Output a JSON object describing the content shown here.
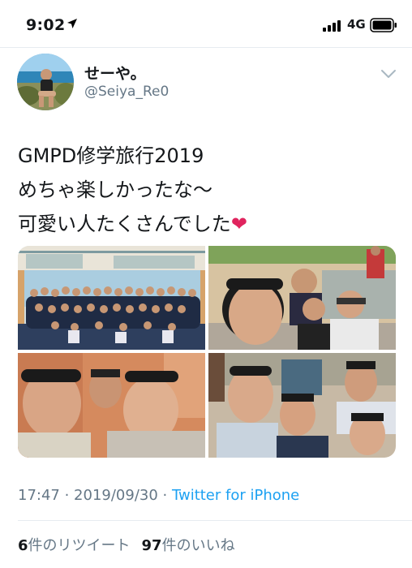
{
  "status_bar": {
    "time": "9:02",
    "network": "4G"
  },
  "tweet": {
    "display_name": "せーや。",
    "handle": "@Seiya_Re0",
    "text_lines": [
      "GMPD修学旅行2019",
      "めちゃ楽しかったな〜",
      "可愛い人たくさんでした"
    ],
    "emoji": "❤",
    "timestamp": "17:47 · 2019/09/30 · ",
    "source": "Twitter for iPhone",
    "retweets_count": "6",
    "retweets_label": "件のリツイート",
    "likes_count": "97",
    "likes_label": "件のいいね"
  },
  "colors": {
    "link": "#1da1f2",
    "secondary_text": "#657786",
    "like": "#e0245e"
  },
  "icons": [
    "location-arrow-icon",
    "signal-bars-icon",
    "battery-icon",
    "chevron-down-icon"
  ]
}
